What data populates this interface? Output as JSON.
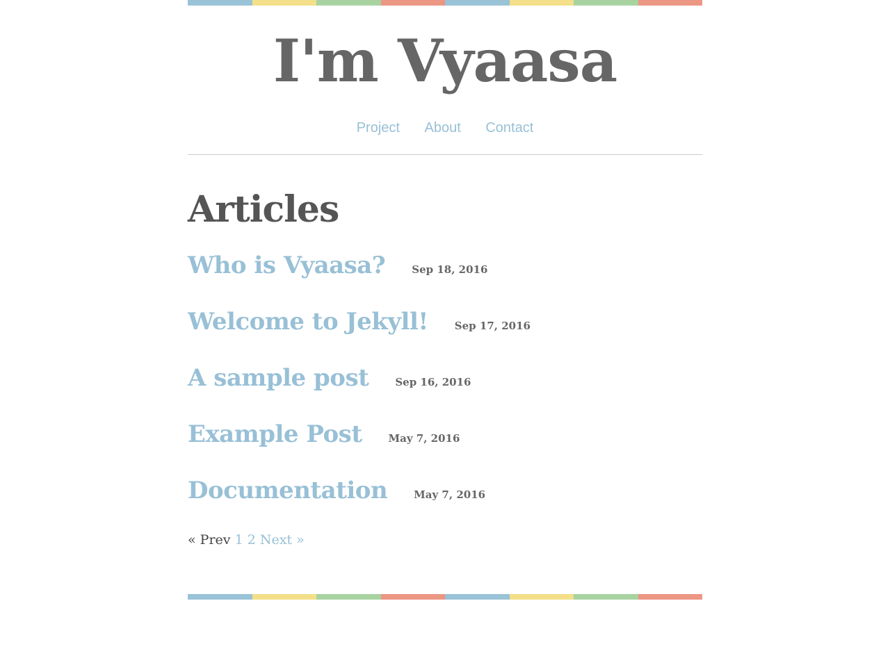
{
  "stripe_colors": [
    "#9ac3d8",
    "#f4df8a",
    "#a8d3a1",
    "#ec9684",
    "#9ac3d8",
    "#f4df8a",
    "#a8d3a1",
    "#ec9684"
  ],
  "header": {
    "site_title": "I'm Vyaasa"
  },
  "nav": {
    "items": [
      {
        "label": "Project"
      },
      {
        "label": "About"
      },
      {
        "label": "Contact"
      }
    ]
  },
  "main": {
    "title": "Articles",
    "posts": [
      {
        "title": "Who is Vyaasa?",
        "date": "Sep 18, 2016"
      },
      {
        "title": "Welcome to Jekyll!",
        "date": "Sep 17, 2016"
      },
      {
        "title": "A sample post",
        "date": "Sep 16, 2016"
      },
      {
        "title": "Example Post",
        "date": "May 7, 2016"
      },
      {
        "title": "Documentation",
        "date": "May 7, 2016"
      }
    ]
  },
  "pagination": {
    "prev_label": "« Prev",
    "pages": [
      "1",
      "2"
    ],
    "next_label": "Next »"
  },
  "colors": {
    "link": "#98c0d6",
    "title": "#666666",
    "text": "#444444"
  }
}
